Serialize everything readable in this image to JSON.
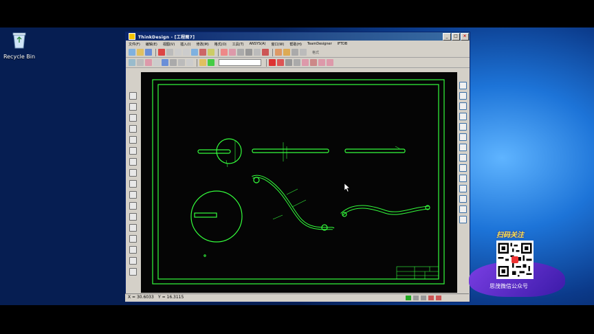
{
  "desktop": {
    "recycle_bin_label": "Recycle Bin"
  },
  "window": {
    "title": "ThinkDesign  - [工程图7]",
    "menu": [
      "文件(F)",
      "编辑(E)",
      "视图(V)",
      "插入(I)",
      "修改(M)",
      "格式(O)",
      "工具(T)",
      "ANSYS(A)",
      "窗口(W)",
      "帮助(H)",
      "TeamDesigner",
      "IFTDB"
    ],
    "toolbar_label": "格式"
  },
  "status": {
    "x": "X = 30.6033",
    "y": "Y = 16.3115"
  },
  "promo": {
    "title": "扫码关注",
    "caption": "思茂微信公众号"
  },
  "colors": {
    "cad_line": "#34ff3c",
    "canvas_bg": "#050505",
    "title_bar": "#0a246a",
    "promo_title": "#ffe94a"
  }
}
